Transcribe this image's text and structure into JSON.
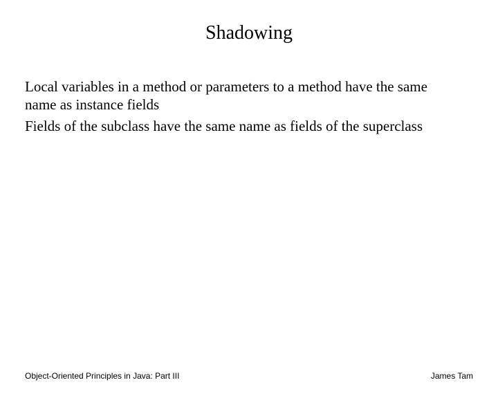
{
  "title": "Shadowing",
  "paragraphs": {
    "p1": "Local variables in a method or parameters to a method have the same name as instance fields",
    "p2": "Fields of the subclass have the same name as fields of the superclass"
  },
  "footer": {
    "left": "Object-Oriented Principles in Java: Part III",
    "right": "James Tam"
  }
}
